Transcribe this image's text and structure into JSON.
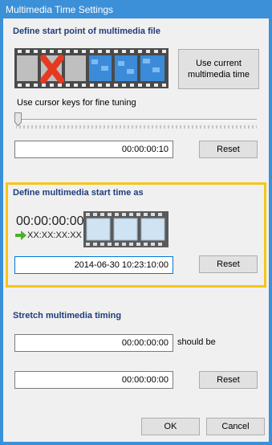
{
  "window": {
    "title": "Multimedia Time Settings"
  },
  "section_start": {
    "heading": "Define start point of multimedia file",
    "use_current_label": "Use current multimedia time",
    "slider_label": "Use cursor keys for fine tuning",
    "slider_value_fraction": 0.0,
    "time_value": "00:00:00:10",
    "reset_label": "Reset"
  },
  "section_define": {
    "heading": "Define multimedia start time as",
    "timecode": "00:00:00:00",
    "target_timecode": "XX:XX:XX:XX",
    "datetime_value": "2014-06-30 10:23:10:00",
    "reset_label": "Reset"
  },
  "section_stretch": {
    "heading": "Stretch multimedia timing",
    "time1_value": "00:00:00:00",
    "should_be_label": "should be",
    "time2_value": "00:00:00:00",
    "reset_label": "Reset"
  },
  "footer": {
    "ok_label": "OK",
    "cancel_label": "Cancel"
  },
  "colors": {
    "titlebar": "#3c90d8",
    "heading": "#1f3d7a",
    "highlight": "#f5c518",
    "film_blue": "#3b8bd9",
    "red_x": "#e53a1f",
    "arrow_green": "#4caf2a"
  },
  "icons": {
    "film_strip_excluded": "film-strip-with-red-x-icon",
    "film_strip_start": "film-strip-icon",
    "arrow": "green-arrow-right-icon"
  }
}
